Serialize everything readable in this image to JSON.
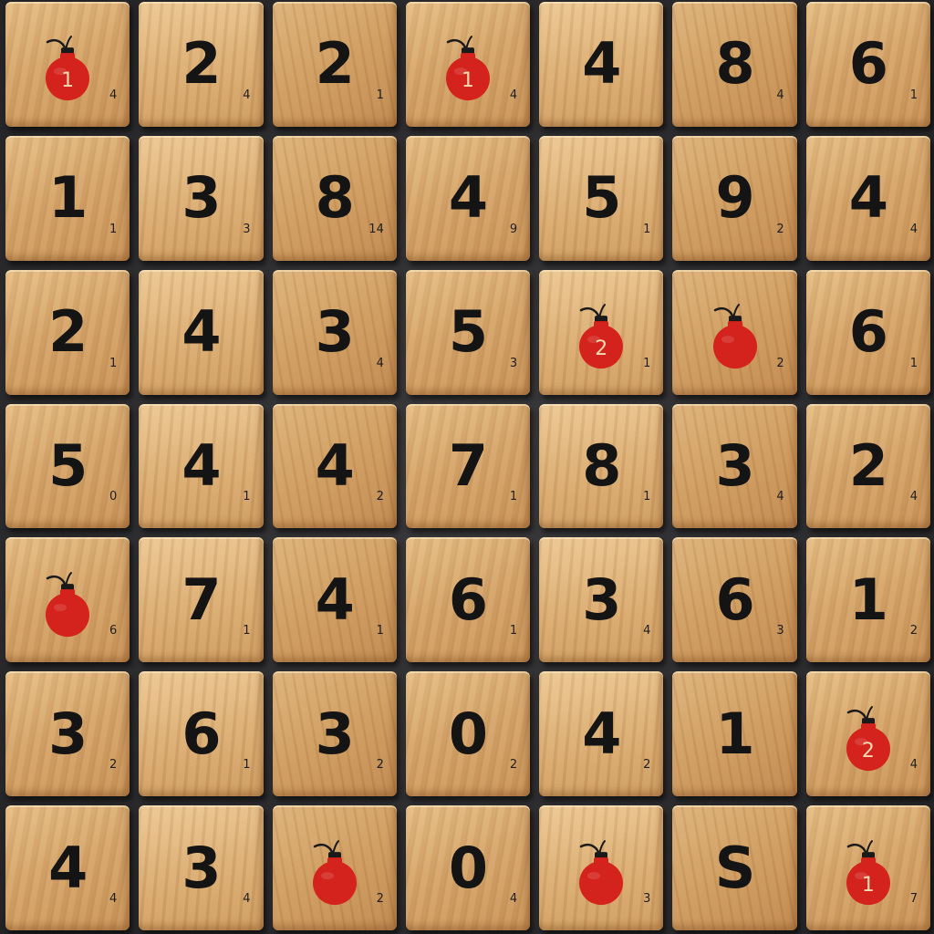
{
  "board": {
    "rows": [
      [
        {
          "type": "bomb",
          "value": "1",
          "sub": "4"
        },
        {
          "type": "number",
          "value": "2",
          "sub": "4"
        },
        {
          "type": "number",
          "value": "2",
          "sub": "1"
        },
        {
          "type": "bomb",
          "value": "1",
          "sub": "4"
        },
        {
          "type": "number",
          "value": "4",
          "sub": ""
        },
        {
          "type": "number",
          "value": "8",
          "sub": "4"
        },
        {
          "type": "number",
          "value": "6",
          "sub": "1"
        }
      ],
      [
        {
          "type": "number",
          "value": "1",
          "sub": "1"
        },
        {
          "type": "number",
          "value": "3",
          "sub": "3"
        },
        {
          "type": "number",
          "value": "8",
          "sub": "14"
        },
        {
          "type": "number",
          "value": "4",
          "sub": "9"
        },
        {
          "type": "number",
          "value": "5",
          "sub": "1"
        },
        {
          "type": "number",
          "value": "9",
          "sub": "2"
        },
        {
          "type": "number",
          "value": "4",
          "sub": "4"
        }
      ],
      [
        {
          "type": "number",
          "value": "2",
          "sub": "1"
        },
        {
          "type": "number",
          "value": "4",
          "sub": ""
        },
        {
          "type": "number",
          "value": "3",
          "sub": "4"
        },
        {
          "type": "number",
          "value": "5",
          "sub": "3"
        },
        {
          "type": "bomb",
          "value": "2",
          "sub": "1"
        },
        {
          "type": "bomb",
          "value": "",
          "sub": "2"
        },
        {
          "type": "number",
          "value": "6",
          "sub": "1"
        }
      ],
      [
        {
          "type": "number",
          "value": "5",
          "sub": "0"
        },
        {
          "type": "number",
          "value": "4",
          "sub": "1"
        },
        {
          "type": "number",
          "value": "4",
          "sub": "2"
        },
        {
          "type": "number",
          "value": "7",
          "sub": "1"
        },
        {
          "type": "number",
          "value": "8",
          "sub": "1"
        },
        {
          "type": "number",
          "value": "3",
          "sub": "4"
        },
        {
          "type": "number",
          "value": "2",
          "sub": "4"
        }
      ],
      [
        {
          "type": "bomb",
          "value": "",
          "sub": "6"
        },
        {
          "type": "number",
          "value": "7",
          "sub": "1"
        },
        {
          "type": "number",
          "value": "4",
          "sub": "1"
        },
        {
          "type": "number",
          "value": "6",
          "sub": "1"
        },
        {
          "type": "number",
          "value": "3",
          "sub": "4"
        },
        {
          "type": "number",
          "value": "6",
          "sub": "3"
        },
        {
          "type": "number",
          "value": "1",
          "sub": "2"
        }
      ],
      [
        {
          "type": "number",
          "value": "3",
          "sub": "2"
        },
        {
          "type": "number",
          "value": "6",
          "sub": "1"
        },
        {
          "type": "number",
          "value": "3",
          "sub": "2"
        },
        {
          "type": "number",
          "value": "0",
          "sub": "2"
        },
        {
          "type": "number",
          "value": "4",
          "sub": "2"
        },
        {
          "type": "number",
          "value": "1",
          "sub": ""
        },
        {
          "type": "bomb",
          "value": "2",
          "sub": "4"
        }
      ],
      [
        {
          "type": "number",
          "value": "4",
          "sub": "4"
        },
        {
          "type": "number",
          "value": "3",
          "sub": "4"
        },
        {
          "type": "bomb",
          "value": "",
          "sub": "2"
        },
        {
          "type": "number",
          "value": "0",
          "sub": "4"
        },
        {
          "type": "bomb",
          "value": "",
          "sub": "3"
        },
        {
          "type": "number",
          "value": "S",
          "sub": ""
        },
        {
          "type": "bomb",
          "value": "1",
          "sub": "7"
        }
      ]
    ]
  },
  "colors": {
    "number_ink": "#141414",
    "bomb_red": "#d4231c",
    "bomb_label": "#f3dcb2",
    "background": "#2b2b2d"
  },
  "icons": {
    "bomb": "bomb-icon"
  }
}
